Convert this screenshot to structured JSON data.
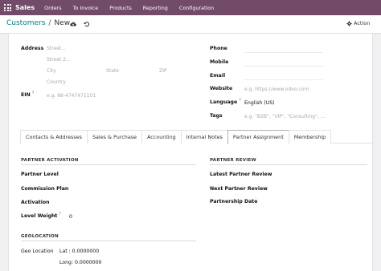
{
  "navbar": {
    "brand": "Sales",
    "menu": [
      "Orders",
      "To Invoice",
      "Products",
      "Reporting",
      "Configuration"
    ]
  },
  "control": {
    "breadcrumb_parent": "Customers",
    "breadcrumb_sep": "/",
    "breadcrumb_current": "New",
    "action_label": "Action"
  },
  "form": {
    "address_label": "Address",
    "street_ph": "Street...",
    "street2_ph": "Street 2...",
    "city_ph": "City",
    "state_ph": "State",
    "zip_ph": "ZIP",
    "country_ph": "Country",
    "ein_label": "EIN",
    "ein_sup": "?",
    "ein_ph": "e.g. 88-4747471101",
    "phone_label": "Phone",
    "mobile_label": "Mobile",
    "email_label": "Email",
    "website_label": "Website",
    "website_ph": "e.g. https://www.odoo.com",
    "language_label": "Language",
    "language_sup": "?",
    "language_value": "English (US)",
    "tags_label": "Tags",
    "tags_ph": "e.g. \"B2B\", \"VIP\", \"Consulting\", ..."
  },
  "tabs": [
    {
      "label": "Contacts & Addresses"
    },
    {
      "label": "Sales & Purchase"
    },
    {
      "label": "Accounting"
    },
    {
      "label": "Internal Notes"
    },
    {
      "label": "Partner Assignment"
    },
    {
      "label": "Membership"
    }
  ],
  "active_tab": "Partner Assignment",
  "partner_activation": {
    "title": "PARTNER ACTIVATION",
    "partner_level_label": "Partner Level",
    "commission_plan_label": "Commission Plan",
    "activation_label": "Activation",
    "level_weight_label": "Level Weight",
    "level_weight_sup": "?",
    "level_weight_value": "0"
  },
  "partner_review": {
    "title": "PARTNER REVIEW",
    "latest_review_label": "Latest Partner Review",
    "next_review_label": "Next Partner Review",
    "partnership_date_label": "Partnership Date"
  },
  "geolocation": {
    "title": "GEOLOCATION",
    "geo_location_label": "Geo Location",
    "lat_text": "Lat : 0.0000000",
    "long_text": "Long: 0.0000000"
  },
  "colors": {
    "navbar": "#714b67",
    "link": "#017e84"
  }
}
